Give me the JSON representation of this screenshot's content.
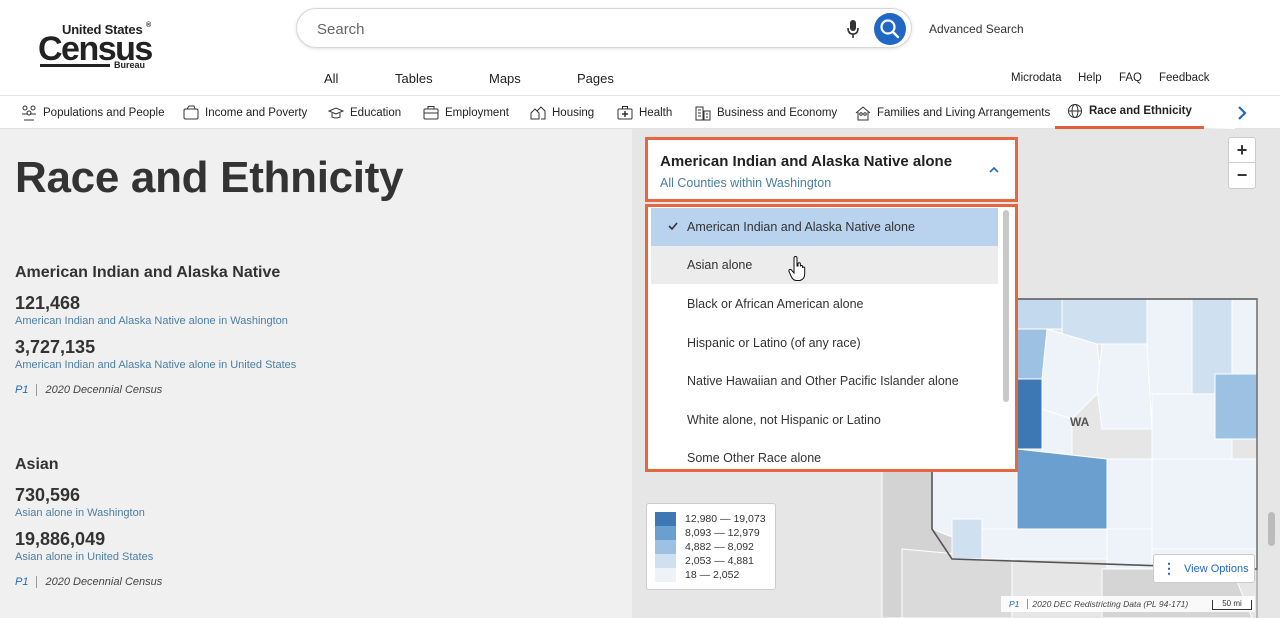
{
  "logo": {
    "line1": "United States",
    "reg": "®",
    "line2": "Census",
    "line3": "Bureau"
  },
  "search": {
    "placeholder": "Search",
    "advanced": "Advanced Search"
  },
  "scope_tabs": [
    "All",
    "Tables",
    "Maps",
    "Pages"
  ],
  "util_links": [
    "Microdata",
    "Help",
    "FAQ",
    "Feedback"
  ],
  "categories": [
    {
      "label": "Populations and People",
      "icon": "people-icon"
    },
    {
      "label": "Income and Poverty",
      "icon": "wallet-icon"
    },
    {
      "label": "Education",
      "icon": "graduation-cap-icon"
    },
    {
      "label": "Employment",
      "icon": "briefcase-icon"
    },
    {
      "label": "Housing",
      "icon": "houses-icon"
    },
    {
      "label": "Health",
      "icon": "medical-kit-icon"
    },
    {
      "label": "Business and Economy",
      "icon": "buildings-icon"
    },
    {
      "label": "Families and Living Arrangements",
      "icon": "family-home-icon"
    },
    {
      "label": "Race and Ethnicity",
      "icon": "globe-people-icon"
    }
  ],
  "active_category": "Race and Ethnicity",
  "page_title": "Race and Ethnicity",
  "sections": [
    {
      "heading": "American Indian and Alaska Native",
      "stat1_value": "121,468",
      "stat1_label": "American Indian and Alaska Native alone in Washington",
      "stat2_value": "3,727,135",
      "stat2_label": "American Indian and Alaska Native alone in United States",
      "source_table": "P1",
      "source_name": "2020 Decennial Census"
    },
    {
      "heading": "Asian",
      "stat1_value": "730,596",
      "stat1_label": "Asian alone in Washington",
      "stat2_value": "19,886,049",
      "stat2_label": "Asian alone in United States",
      "source_table": "P1",
      "source_name": "2020 Decennial Census"
    }
  ],
  "dropdown": {
    "selected": "American Indian and Alaska Native alone",
    "geography": "All Counties within Washington",
    "options": [
      "American Indian and Alaska Native alone",
      "Asian alone",
      "Black or African American alone",
      "Hispanic or Latino (of any race)",
      "Native Hawaiian and Other Pacific Islander alone",
      "White alone, not Hispanic or Latino",
      "Some Other Race alone"
    ],
    "hovered": "Asian alone"
  },
  "map": {
    "state_label": "WA",
    "legend": [
      {
        "range": "12,980 — 19,073",
        "color": "#3d78b5"
      },
      {
        "range": "8,093 — 12,979",
        "color": "#6a9fd0"
      },
      {
        "range": "4,882 — 8,092",
        "color": "#9cc1e3"
      },
      {
        "range": "2,053 — 4,881",
        "color": "#cfe0f1"
      },
      {
        "range": "18 — 2,052",
        "color": "#eef3fa"
      }
    ],
    "view_options": "View Options",
    "attribution_table": "P1",
    "attribution_text": "2020 DEC Redistricting Data (PL 94-171)",
    "scale": "50 mi",
    "zoom_in": "+",
    "zoom_out": "−"
  }
}
